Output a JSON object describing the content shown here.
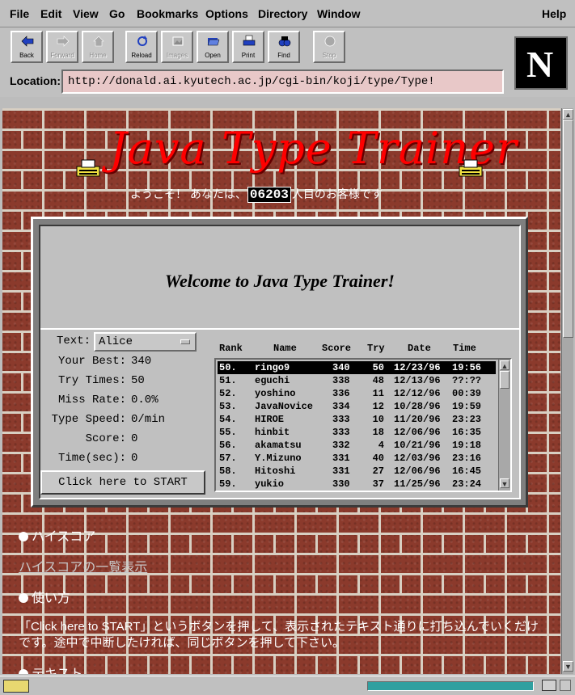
{
  "menu": [
    "File",
    "Edit",
    "View",
    "Go",
    "Bookmarks",
    "Options",
    "Directory",
    "Window",
    "Help"
  ],
  "toolbar": {
    "buttons": [
      {
        "label": "Back",
        "icon": "back-arrow-icon",
        "enabled": true
      },
      {
        "label": "Forward",
        "icon": "forward-arrow-icon",
        "enabled": false
      },
      {
        "label": "Home",
        "icon": "home-icon",
        "enabled": false
      },
      {
        "label": "Reload",
        "icon": "reload-icon",
        "enabled": true
      },
      {
        "label": "Images",
        "icon": "images-icon",
        "enabled": false
      },
      {
        "label": "Open",
        "icon": "open-icon",
        "enabled": true
      },
      {
        "label": "Print",
        "icon": "print-icon",
        "enabled": true
      },
      {
        "label": "Find",
        "icon": "find-icon",
        "enabled": true
      },
      {
        "label": "Stop",
        "icon": "stop-icon",
        "enabled": false
      }
    ],
    "logo_letter": "N"
  },
  "location": {
    "label": "Location:",
    "url": "http://donald.ai.kyutech.ac.jp/cgi-bin/koji/type/Type!"
  },
  "page": {
    "title": "Java Type Trainer",
    "welcome_pre": "ようこそ！ あなたは、",
    "counter": "06203",
    "welcome_post": "人目のお客様です",
    "applet": {
      "banner": "Welcome to Java Type Trainer!",
      "text_label": "Text:",
      "text_value": "Alice",
      "stats": [
        {
          "label": "Your Best:",
          "value": "340"
        },
        {
          "label": "Try Times:",
          "value": "50"
        },
        {
          "label": "Miss Rate:",
          "value": "0.0%"
        },
        {
          "label": "Type Speed:",
          "value": "0/min"
        },
        {
          "label": "Score:",
          "value": "0"
        },
        {
          "label": "Time(sec):",
          "value": "0"
        }
      ],
      "start_button": "Click here to START",
      "columns": [
        "Rank",
        "Name",
        "Score",
        "Try",
        "Date",
        "Time"
      ],
      "rows": [
        {
          "rank": "50.",
          "name": "ringo9",
          "score": "340",
          "try": "50",
          "date": "12/23/96",
          "time": "19:56",
          "selected": true
        },
        {
          "rank": "51.",
          "name": "eguchi",
          "score": "338",
          "try": "48",
          "date": "12/13/96",
          "time": "??:??"
        },
        {
          "rank": "52.",
          "name": "yoshino",
          "score": "336",
          "try": "11",
          "date": "12/12/96",
          "time": "00:39"
        },
        {
          "rank": "53.",
          "name": "JavaNovice",
          "score": "334",
          "try": "12",
          "date": "10/28/96",
          "time": "19:59"
        },
        {
          "rank": "54.",
          "name": "HIROE",
          "score": "333",
          "try": "10",
          "date": "11/20/96",
          "time": "23:23"
        },
        {
          "rank": "55.",
          "name": "hinbit",
          "score": "333",
          "try": "18",
          "date": "12/06/96",
          "time": "16:35"
        },
        {
          "rank": "56.",
          "name": "akamatsu",
          "score": "332",
          "try": "4",
          "date": "10/21/96",
          "time": "19:18"
        },
        {
          "rank": "57.",
          "name": "Y.Mizuno",
          "score": "331",
          "try": "40",
          "date": "12/03/96",
          "time": "23:16"
        },
        {
          "rank": "58.",
          "name": "Hitoshi",
          "score": "331",
          "try": "27",
          "date": "12/06/96",
          "time": "16:45"
        },
        {
          "rank": "59.",
          "name": "yukio",
          "score": "330",
          "try": "37",
          "date": "11/25/96",
          "time": "23:24"
        }
      ]
    },
    "sections": {
      "highscore_heading": "ハイスコア",
      "highscore_link": "ハイスコアの一覧表示",
      "usage_heading": "使い方",
      "usage_text": "「Click here to START」というボタンを押して、表示されたテキスト通りに打ち込んでいくだけです。途中で中断したければ、同じボタンを押して下さい。",
      "text_heading": "テキスト"
    }
  },
  "colors": {
    "chrome": "#c0c0c0",
    "brick": "#8b3a2c",
    "title_red": "#ff0000",
    "location_field": "#e8c8c8",
    "progress": "#30a0a0"
  }
}
